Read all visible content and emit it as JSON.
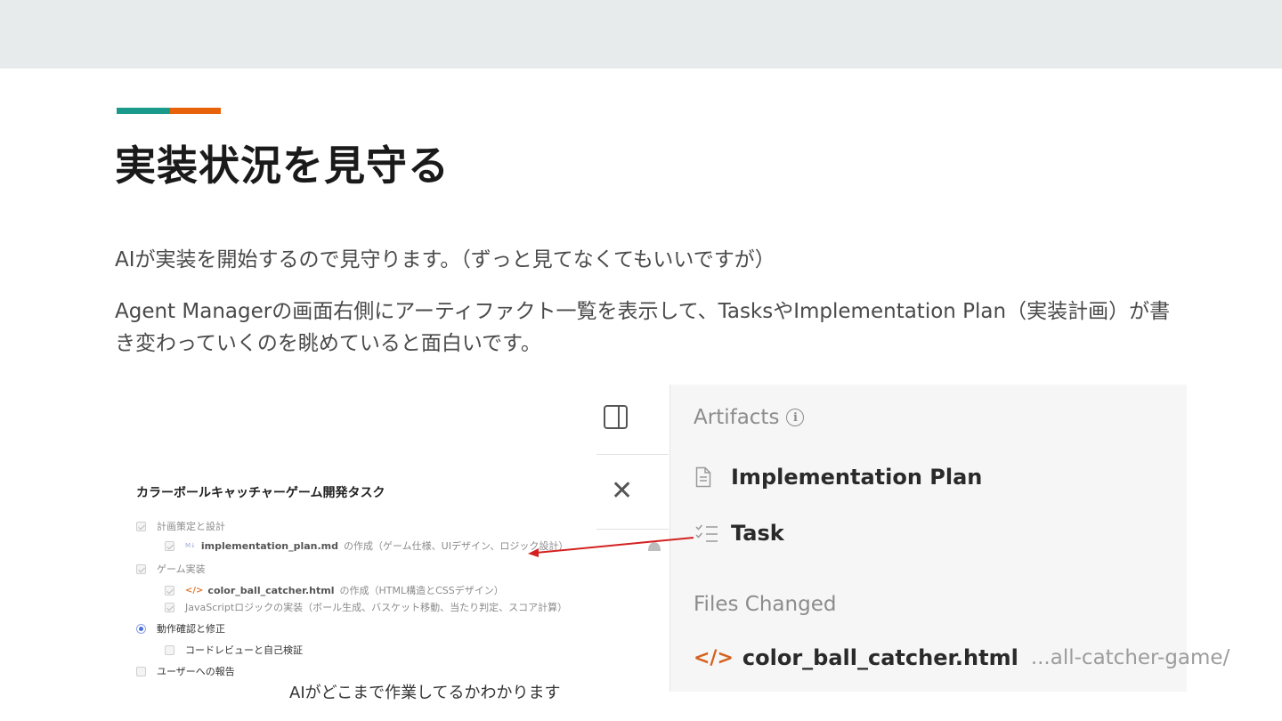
{
  "colors": {
    "teal": "#1a9a8a",
    "orange": "#e8620a",
    "arrow": "#d42020"
  },
  "slide": {
    "title": "実装状況を見守る",
    "paragraph1": "AIが実装を開始するので見守ります。（ずっと見てなくてもいいですが）",
    "paragraph2": "Agent Managerの画面右側にアーティファクト一覧を表示して、TasksやImplementation Plan（実装計画）が書き変わっていくのを眺めていると面白いです。",
    "caption": "AIがどこまで作業してるかわかります"
  },
  "task_list": {
    "title": "カラーボールキャッチャーゲーム開発タスク",
    "items": [
      {
        "text": "計画策定と設計",
        "state": "checked"
      },
      {
        "file": "implementation_plan.md",
        "icon": "markdown-icon",
        "text": "の作成（ゲーム仕様、UIデザイン、ロジック設計）",
        "state": "checked"
      },
      {
        "text": "ゲーム実装",
        "state": "checked"
      },
      {
        "file": "color_ball_catcher.html",
        "icon": "code-icon",
        "text": "の作成（HTML構造とCSSデザイン）",
        "state": "checked"
      },
      {
        "text": "JavaScriptロジックの実装（ボール生成、バスケット移動、当たり判定、スコア計算）",
        "state": "checked"
      },
      {
        "text": "動作確認と修正",
        "state": "current"
      },
      {
        "text": "コードレビューと自己検証",
        "state": "unchecked"
      },
      {
        "text": "ユーザーへの報告",
        "state": "unchecked"
      }
    ]
  },
  "artifacts_panel": {
    "heading": "Artifacts",
    "items": [
      {
        "label": "Implementation Plan",
        "icon": "document-icon"
      },
      {
        "label": "Task",
        "icon": "checklist-icon"
      }
    ],
    "files_heading": "Files Changed",
    "files": [
      {
        "name": "color_ball_catcher.html",
        "path": "...all-catcher-game/",
        "icon": "code-icon"
      }
    ]
  }
}
